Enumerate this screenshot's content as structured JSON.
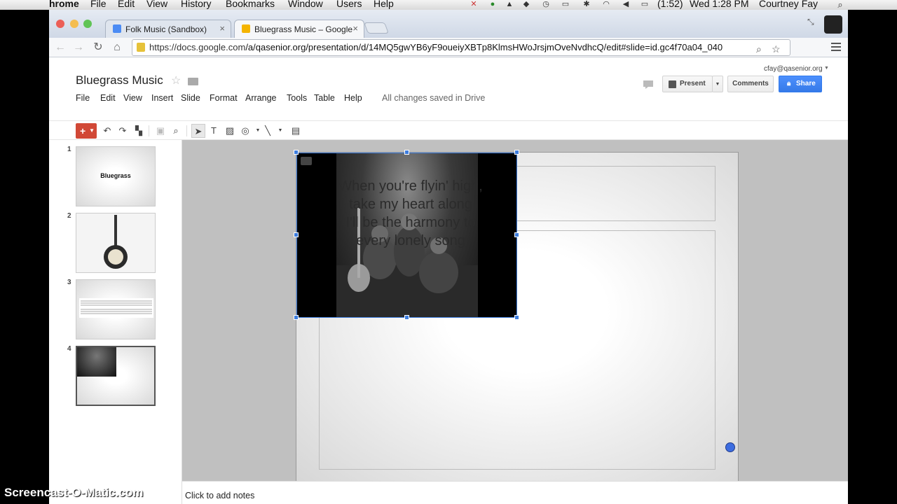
{
  "os_menubar": {
    "app_name": "hrome",
    "items": [
      "File",
      "Edit",
      "View",
      "History",
      "Bookmarks",
      "Window",
      "Users",
      "Help"
    ],
    "battery": "(1:52)",
    "clock": "Wed 1:28 PM",
    "user": "Courtney Fay"
  },
  "browser": {
    "tabs": [
      {
        "title": "Folk Music (Sandbox)",
        "close": "×",
        "favicon_color": "#4b8bf4"
      },
      {
        "title": "Bluegrass Music – Google",
        "close": "×",
        "favicon_color": "#f4b400"
      }
    ],
    "url_host": "https://docs.google.com",
    "url_path": "/a/qasenior.org/presentation/d/14MQ5gwYB6yF9oueiyXBTp8KlmsHWoJrsjmOveNvdhcQ/edit#slide=id.gc4f70a04_040"
  },
  "doc": {
    "title": "Bluegrass Music",
    "star": "☆",
    "menus": [
      "File",
      "Edit",
      "View",
      "Insert",
      "Slide",
      "Format",
      "Arrange",
      "Tools",
      "Table",
      "Help"
    ],
    "save_status": "All changes saved in Drive",
    "account": "cfay@qasenior.org",
    "present_label": "Present",
    "comments_label": "Comments",
    "share_label": "Share"
  },
  "filmstrip": {
    "slides": [
      {
        "number": "1",
        "title": "Bluegrass"
      },
      {
        "number": "2",
        "title": ""
      },
      {
        "number": "3",
        "title": ""
      },
      {
        "number": "4",
        "title": ""
      }
    ],
    "selected_index": 4
  },
  "slide": {
    "lyrics": [
      "When you're flyin' high,",
      "take my heart along",
      "I'll be the harmony to",
      "every lonely song"
    ]
  },
  "notes": {
    "placeholder": "Click to add notes"
  },
  "watermark": "Screencast-O-Matic.com",
  "colors": {
    "accent_blue": "#4d90fe",
    "new_slide_red": "#d14836",
    "selection_blue": "#3d7dde"
  }
}
